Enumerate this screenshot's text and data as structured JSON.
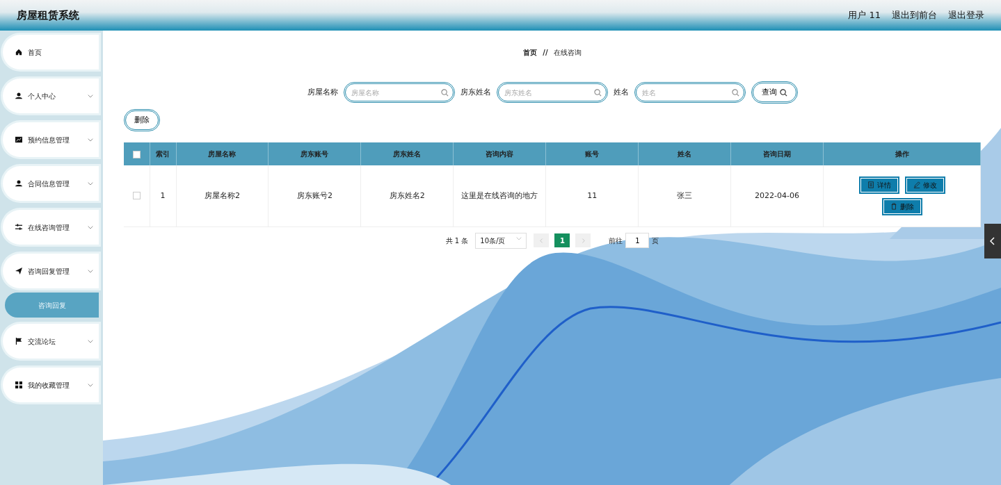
{
  "header": {
    "title": "房屋租赁系统",
    "links": [
      "用户 11",
      "退出到前台",
      "退出登录"
    ]
  },
  "sidebar": {
    "items": [
      {
        "label": "首页",
        "kind": "link"
      },
      {
        "label": "个人中心",
        "kind": "menu"
      },
      {
        "label": "预约信息管理",
        "kind": "menu"
      },
      {
        "label": "合同信息管理",
        "kind": "menu"
      },
      {
        "label": "在线咨询管理",
        "kind": "menu"
      },
      {
        "label": "咨询回复管理",
        "kind": "menu",
        "children": [
          {
            "label": "咨询回复",
            "selected": true
          }
        ]
      },
      {
        "label": "交流论坛",
        "kind": "menu"
      },
      {
        "label": "我的收藏管理",
        "kind": "menu"
      }
    ]
  },
  "breadcrumb": {
    "items": [
      "首页",
      "在线咨询"
    ],
    "separator": "//"
  },
  "search": {
    "fields": [
      {
        "label": "房屋名称",
        "placeholder": "房屋名称"
      },
      {
        "label": "房东姓名",
        "placeholder": "房东姓名"
      },
      {
        "label": "姓名",
        "placeholder": "姓名"
      }
    ],
    "button": "查询"
  },
  "toolbar": {
    "delete_button": "删除"
  },
  "table": {
    "columns": [
      "索引",
      "房屋名称",
      "房东账号",
      "房东姓名",
      "咨询内容",
      "账号",
      "姓名",
      "咨询日期",
      "操作"
    ],
    "header_checked": false,
    "rows": [
      {
        "checked": false,
        "cells": [
          "1",
          "房屋名称2",
          "房东账号2",
          "房东姓名2",
          "这里是在线咨询的地方",
          "11",
          "张三",
          "2022-04-06"
        ],
        "actions": [
          {
            "kind": "detail",
            "label": "详情"
          },
          {
            "kind": "edit",
            "label": "修改"
          },
          {
            "kind": "delete",
            "label": "删除"
          }
        ]
      }
    ]
  },
  "pagination": {
    "total": "共 1 条",
    "page_size": "10条/页",
    "pages": [
      {
        "label": "1",
        "selected": true
      }
    ],
    "goto_label": "前往",
    "goto_value": "1",
    "page_unit": "页"
  }
}
